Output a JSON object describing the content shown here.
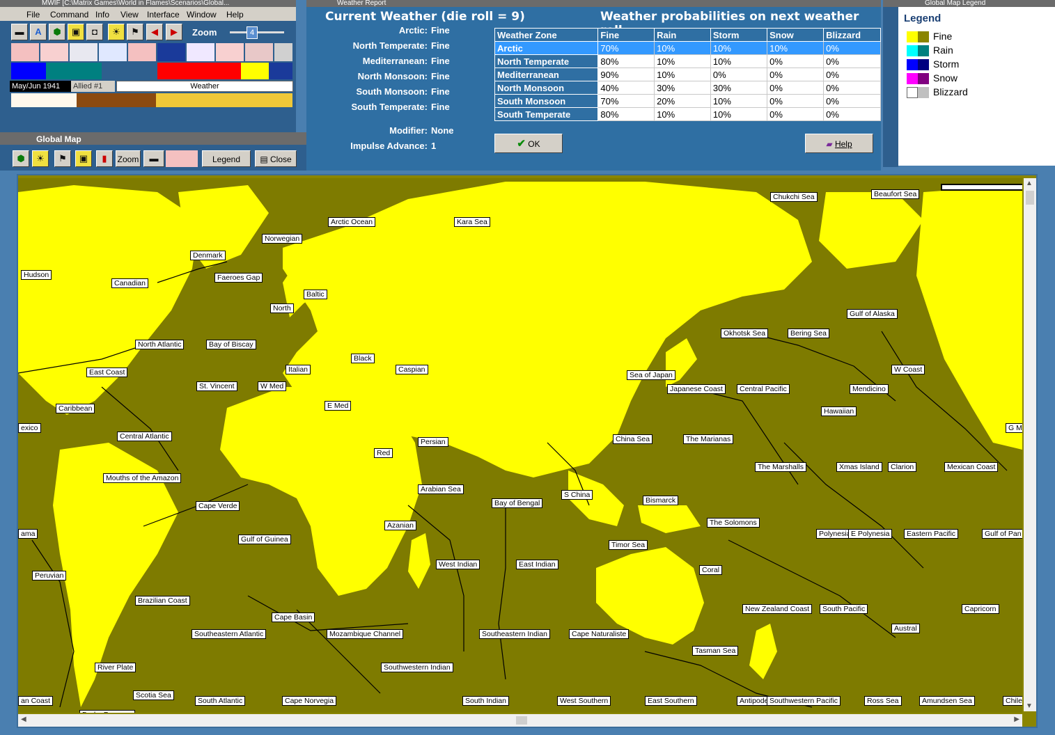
{
  "main_window": {
    "title": "MWIF [C:\\Matrix Games\\World in Flames\\Scenarios\\Global...",
    "menu": [
      "File",
      "Command",
      "Info",
      "View",
      "Interface",
      "Window",
      "Help"
    ],
    "zoom_label": "Zoom",
    "zoom_value": "4",
    "date": "May/Jun 1941",
    "side_turn": "Allied #1",
    "mode": "Weather"
  },
  "global_map_toolbar": {
    "title": "Global Map",
    "zoom_label": "Zoom",
    "legend_label": "Legend",
    "close_label": "Close"
  },
  "weather_report": {
    "window_title": "Weather Report",
    "heading": "Current Weather (die roll = 9)",
    "prob_heading": "Weather probabilities on next weather roll",
    "current": [
      {
        "zone": "Arctic:",
        "value": "Fine"
      },
      {
        "zone": "North Temperate:",
        "value": "Fine"
      },
      {
        "zone": "Mediterranean:",
        "value": "Fine"
      },
      {
        "zone": "North Monsoon:",
        "value": "Fine"
      },
      {
        "zone": "South Monsoon:",
        "value": "Fine"
      },
      {
        "zone": "South Temperate:",
        "value": "Fine"
      }
    ],
    "modifier_label": "Modifier:",
    "modifier_value": "None",
    "impulse_label": "Impulse Advance:",
    "impulse_value": "1",
    "table_headers": [
      "Weather Zone",
      "Fine",
      "Rain",
      "Storm",
      "Snow",
      "Blizzard"
    ],
    "table_rows": [
      [
        "Arctic",
        "70%",
        "10%",
        "10%",
        "10%",
        "0%"
      ],
      [
        "North Temperate",
        "80%",
        "10%",
        "10%",
        "0%",
        "0%"
      ],
      [
        "Mediterranean",
        "90%",
        "10%",
        "0%",
        "0%",
        "0%"
      ],
      [
        "North Monsoon",
        "40%",
        "30%",
        "30%",
        "0%",
        "0%"
      ],
      [
        "South Monsoon",
        "70%",
        "20%",
        "10%",
        "0%",
        "0%"
      ],
      [
        "South Temperate",
        "80%",
        "10%",
        "10%",
        "0%",
        "0%"
      ]
    ],
    "ok_label": "OK",
    "help_label": "Help"
  },
  "legend": {
    "window_title": "Global Map Legend",
    "title": "Legend",
    "items": [
      {
        "label": "Fine",
        "c1": "#ffff00",
        "c2": "#8a8500"
      },
      {
        "label": "Rain",
        "c1": "#00ffff",
        "c2": "#008080"
      },
      {
        "label": "Storm",
        "c1": "#0000ff",
        "c2": "#000080"
      },
      {
        "label": "Snow",
        "c1": "#ff00ff",
        "c2": "#800080"
      },
      {
        "label": "Blizzard",
        "c1": "#ffffff",
        "c2": "#c0c0c0"
      }
    ]
  },
  "colors": {
    "land_fine": "#ffff00",
    "sea_fine": "#7e7b00",
    "panel_blue": "#2f6fa3"
  },
  "map_labels": [
    "Chukchi Sea",
    "Beaufort Sea",
    "Arctic Ocean",
    "Kara Sea",
    "Norwegian",
    "Denmark",
    "Hudson",
    "Faeroes Gap",
    "Canadian",
    "Baltic",
    "North",
    "Gulf of Alaska",
    "Okhotsk Sea",
    "Bering Sea",
    "North Atlantic",
    "Bay of Biscay",
    "Black",
    "Caspian",
    "W Coast",
    "East Coast",
    "Italian",
    "Sea of Japan",
    "St. Vincent",
    "W Med",
    "Japanese Coast",
    "Central Pacific",
    "Mendicino",
    "E Med",
    "Caribbean",
    "Hawaiian",
    "exico",
    "G M",
    "Central Atlantic",
    "Persian",
    "China Sea",
    "The Marianas",
    "Red",
    "The Marshalls",
    "Xmas Island",
    "Clarion",
    "Mexican Coast",
    "Mouths of the Amazon",
    "Arabian Sea",
    "S China",
    "Bay of Bengal",
    "Bismarck",
    "Cape Verde",
    "Azanian",
    "The Solomons",
    "ama",
    "Gulf of Guinea",
    "Timor Sea",
    "Polynesia",
    "E Polynesia",
    "Eastern Pacific",
    "Gulf of Pan",
    "West Indian",
    "East Indian",
    "Peruvian",
    "Coral",
    "Brazilian Coast",
    "New Zealand Coast",
    "South Pacific",
    "Capricorn",
    "Cape Basin",
    "Austral",
    "Southeastern Atlantic",
    "Mozambique Channel",
    "Southeastern Indian",
    "Cape Naturaliste",
    "Tasman Sea",
    "Southwestern Indian",
    "River Plate",
    "Scotia Sea",
    "an Coast",
    "South Atlantic",
    "Cape Norvegia",
    "South Indian",
    "West Southern",
    "East Southern",
    "Antipodes",
    "Southwestern Pacific",
    "Ross Sea",
    "Amundsen Sea",
    "Chile",
    "Drake Passage"
  ]
}
